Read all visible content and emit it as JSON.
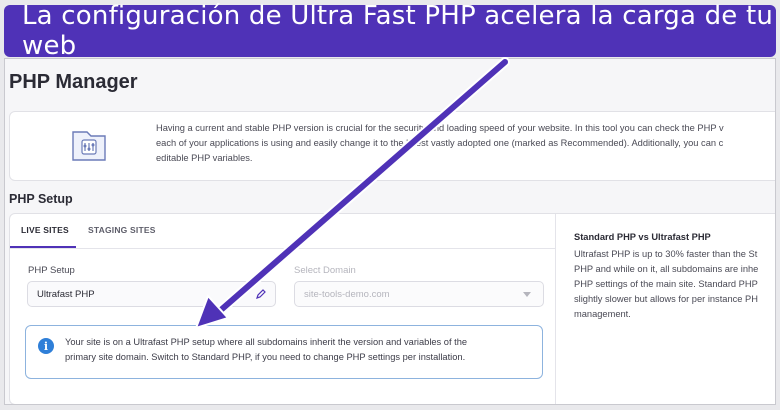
{
  "banner": {
    "caption": "La configuración de Ultra Fast PHP acelera la carga de tu web"
  },
  "page": {
    "title": "PHP Manager"
  },
  "intro": {
    "icon": "settings-document-icon",
    "lines": [
      "Having a current and stable PHP version is crucial for the security and loading speed of your website. In this tool you can check the PHP v",
      "each of your applications is using and easily change it to the latest vastly adopted one (marked as Recommended). Additionally, you can c",
      "editable PHP variables."
    ]
  },
  "setup": {
    "section_title": "PHP Setup",
    "tabs": [
      {
        "label": "LIVE SITES",
        "active": true
      },
      {
        "label": "STAGING SITES",
        "active": false
      }
    ],
    "php_setup_label": "PHP Setup",
    "php_setup_value": "Ultrafast PHP",
    "domain_label": "Select Domain",
    "domain_value": "site-tools-demo.com",
    "notice": {
      "icon": "info-icon",
      "lines": [
        "Your site is on a Ultrafast PHP setup where all subdomains inherit the version and variables of the",
        "primary site domain. Switch to Standard PHP, if you need to change PHP settings per installation."
      ]
    }
  },
  "sidebar_info": {
    "title": "Standard PHP vs Ultrafast PHP",
    "lines": [
      "Ultrafast PHP is up to 30% faster than the St",
      "PHP and while on it, all subdomains are inhe",
      "PHP settings of the main site. Standard PHP",
      "slightly slower but allows for per instance PH",
      "management."
    ]
  },
  "colors": {
    "accent": "#4f32b7",
    "info": "#2f7fd8"
  }
}
